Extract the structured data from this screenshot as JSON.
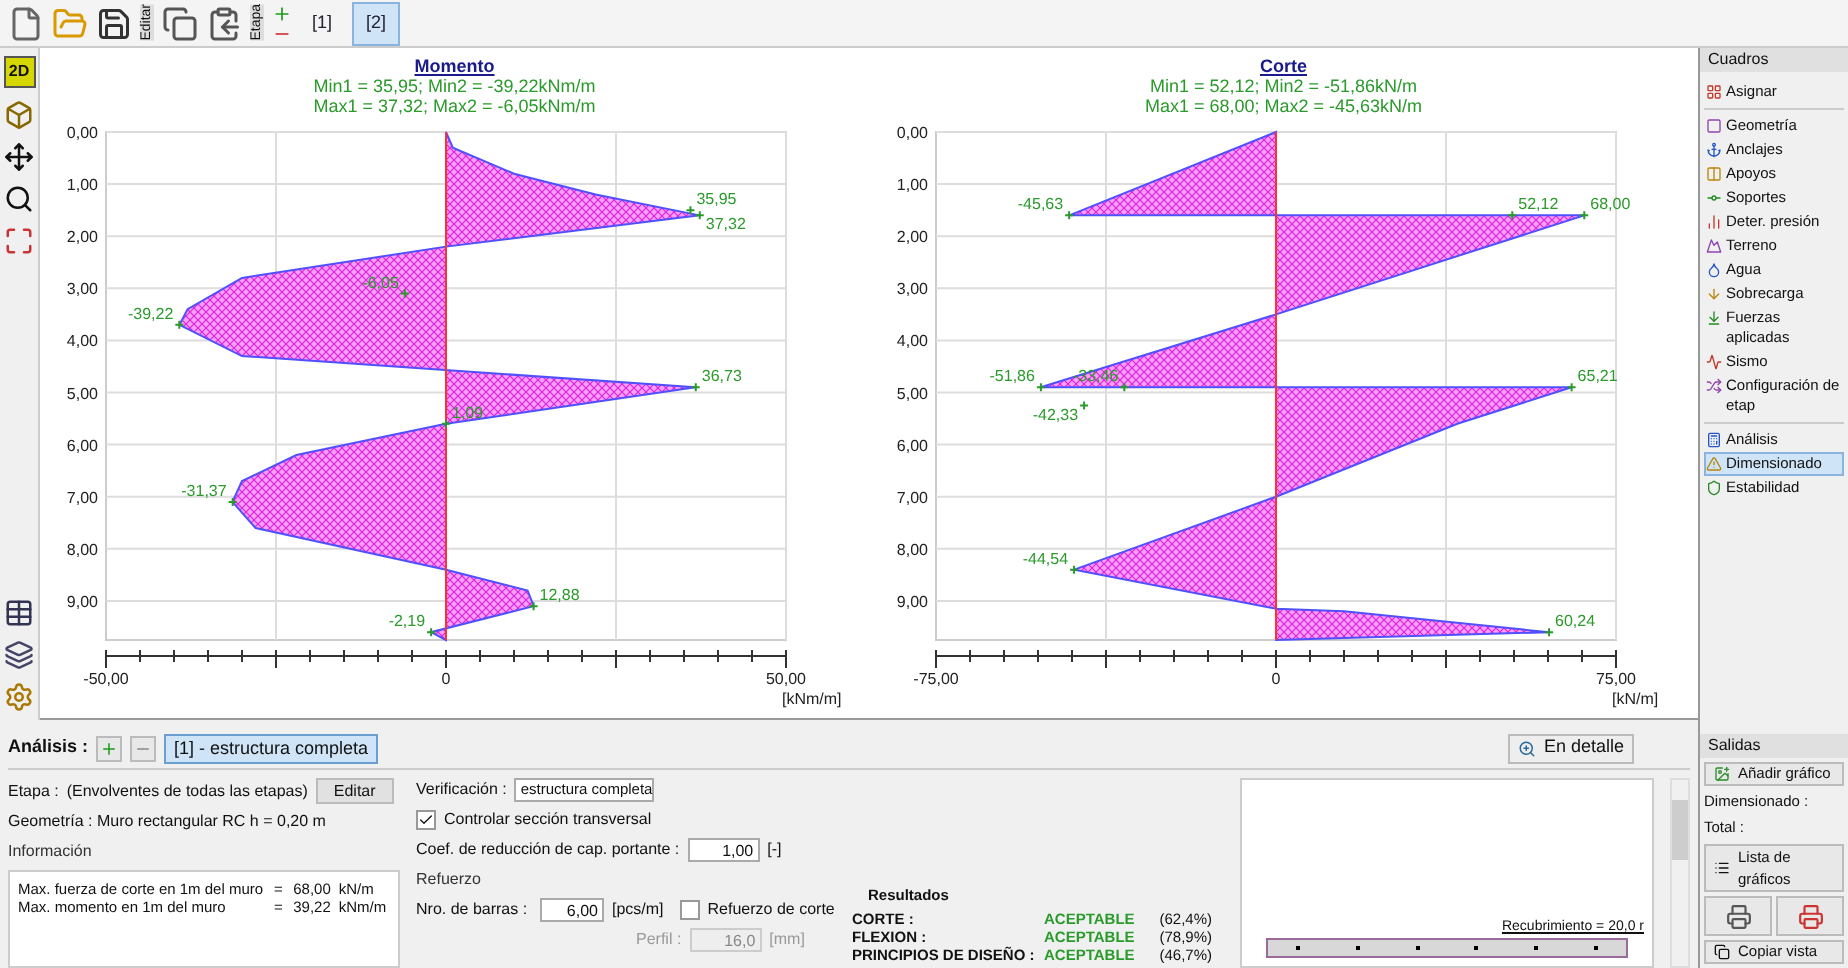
{
  "toolbar": {
    "edit_label": "Editar",
    "stage_label": "Etapa",
    "stages": [
      {
        "label": "[1]",
        "selected": false
      },
      {
        "label": "[2]",
        "selected": true
      }
    ]
  },
  "left_toolbar": {
    "view_button": {
      "label": "2D",
      "selected": true
    }
  },
  "charts": [
    {
      "summary": [
        "Min1 = 35,95; Min2 = -39,22kNm/m",
        "Max1 = 37,32; Max2 = -6,05kNm/m"
      ],
      "chart_data": {
        "type": "area",
        "title": "Momento",
        "orientation": "horizontal",
        "xlabel": "[kNm/m]",
        "grid": true,
        "xlim": [
          -50,
          50
        ],
        "ylim": [
          9.75,
          0
        ],
        "x": [
          0,
          0.3,
          0.8,
          1.2,
          1.6,
          2.2,
          2.8,
          3.4,
          3.7,
          4.3,
          4.9,
          5.6,
          6.2,
          6.7,
          7.1,
          7.6,
          8.4,
          8.8,
          9.1,
          9.6,
          9.75
        ],
        "series": [
          {
            "color": "#5050ff",
            "values": [
              0,
              1,
              10,
              22,
              37.3,
              0,
              -30,
              -38,
              -39.2,
              -30,
              36.7,
              0,
              -22,
              -30,
              -31.4,
              -28,
              0,
              12,
              12.9,
              -2.2,
              0
            ]
          }
        ],
        "xticks": [
          {
            "value": -50,
            "label": "-50,00"
          },
          {
            "value": 0,
            "label": "0"
          },
          {
            "value": 50,
            "label": "50,00"
          }
        ],
        "yticks": [
          {
            "value": 0,
            "label": "0,00"
          },
          {
            "value": 1,
            "label": "1,00"
          },
          {
            "value": 2,
            "label": "2,00"
          },
          {
            "value": 3,
            "label": "3,00"
          },
          {
            "value": 4,
            "label": "4,00"
          },
          {
            "value": 5,
            "label": "5,00"
          },
          {
            "value": 6,
            "label": "6,00"
          },
          {
            "value": 7,
            "label": "7,00"
          },
          {
            "value": 8,
            "label": "8,00"
          },
          {
            "value": 9,
            "label": "9,00"
          }
        ],
        "annotations": [
          {
            "x": 35.95,
            "y": 1.5,
            "text": "35,95"
          },
          {
            "x": 37.32,
            "y": 1.6,
            "text": "37,32"
          },
          "-6,05",
          {
            "x": -39.22,
            "y": 3.7,
            "text": "-39,22"
          },
          {
            "x": 36.73,
            "y": 4.9,
            "text": "36,73"
          },
          {
            "x": 0,
            "y": 5.6,
            "text": "1,09"
          },
          {
            "x": -31.37,
            "y": 7.1,
            "text": "-31,37"
          },
          {
            "x": 12.88,
            "y": 9.1,
            "text": "12,88"
          },
          {
            "x": -2.19,
            "y": 9.6,
            "text": "-2,19"
          }
        ]
      }
    },
    {
      "summary": [
        "Min1 = 52,12; Min2 = -51,86kN/m",
        "Max1 = 68,00; Max2 = -45,63kN/m"
      ],
      "chart_data": {
        "type": "area",
        "title": "Corte",
        "orientation": "horizontal",
        "xlabel": "[kN/m]",
        "grid": true,
        "xlim": [
          -75,
          75
        ],
        "ylim": [
          9.75,
          0
        ],
        "x": [
          0,
          1.6,
          1.6,
          3.5,
          4.9,
          4.9,
          5.6,
          7.0,
          8.4,
          9.15,
          9.2,
          9.6,
          9.75
        ],
        "series": [
          {
            "color": "#5050ff",
            "values": [
              0,
              -45.6,
              68,
              0,
              -51.9,
              65.2,
              40,
              0,
              -44.5,
              0,
              15,
              60.2,
              0
            ]
          }
        ],
        "xticks": [
          {
            "value": -75,
            "label": "-75,00"
          },
          {
            "value": 0,
            "label": "0"
          },
          {
            "value": 75,
            "label": "75,00"
          }
        ],
        "yticks": [
          {
            "value": 0,
            "label": "0,00"
          },
          {
            "value": 1,
            "label": "1,00"
          },
          {
            "value": 2,
            "label": "2,00"
          },
          {
            "value": 3,
            "label": "3,00"
          },
          {
            "value": 4,
            "label": "4,00"
          },
          {
            "value": 5,
            "label": "5,00"
          },
          {
            "value": 6,
            "label": "6,00"
          },
          {
            "value": 7,
            "label": "7,00"
          },
          {
            "value": 8,
            "label": "8,00"
          },
          {
            "value": 9,
            "label": "9,00"
          }
        ],
        "annotations": [
          {
            "x": -45.63,
            "y": 1.6,
            "text": "-45,63"
          },
          {
            "x": 52.12,
            "y": 1.6,
            "text": "52,12"
          },
          {
            "x": 68,
            "y": 1.6,
            "text": "68,00"
          },
          {
            "x": -51.86,
            "y": 4.9,
            "text": "-51,86"
          },
          {
            "x": -33.46,
            "y": 4.9,
            "text": "-33,46"
          },
          "-42,33",
          {
            "x": 65.21,
            "y": 4.9,
            "text": "65,21"
          },
          {
            "x": -44.54,
            "y": 8.4,
            "text": "-44,54"
          },
          {
            "x": 60.24,
            "y": 9.6,
            "text": "60,24"
          }
        ]
      }
    }
  ],
  "analysis": {
    "label": "Análisis :",
    "tabs": [
      {
        "label": "[1] - estructura completa",
        "selected": true
      }
    ],
    "detail_button": "En detalle"
  },
  "stage": {
    "label": "Etapa :",
    "value": "(Envolventes de todas las etapas)",
    "button": "Editar"
  },
  "geometry": "Geometría : Muro rectangular RC h = 0,20 m",
  "information": {
    "title": "Información",
    "lines": [
      {
        "label": "Max. fuerza de corte en 1m del muro",
        "eq": "=",
        "value": "68,00",
        "unit": "kN/m"
      },
      {
        "label": "Max. momento en 1m del muro",
        "eq": "=",
        "value": "39,22",
        "unit": "kNm/m"
      }
    ]
  },
  "verification": {
    "label": "Verificación :",
    "value": "estructura completa"
  },
  "check_section": {
    "label": "Controlar sección transversal",
    "checked": true
  },
  "coef": {
    "label": "Coef. de reducción de cap. portante :",
    "value": "1,00",
    "unit": "[-]"
  },
  "reinforcement": {
    "title": "Refuerzo",
    "bars": {
      "label": "Nro. de barras :",
      "value": "6,00",
      "unit": "[pcs/m]"
    },
    "shear": {
      "label": "Refuerzo de corte",
      "checked": false
    },
    "profile": {
      "label": "Perfil :",
      "value": "16,0",
      "unit": "[mm]",
      "disabled": true
    }
  },
  "results": {
    "title": "Resultados",
    "rows": [
      {
        "name": "CORTE :",
        "status": "ACEPTABLE",
        "percent": "(62,4%)"
      },
      {
        "name": "FLEXION :",
        "status": "ACEPTABLE",
        "percent": "(78,9%)"
      },
      {
        "name": "PRINCIPIOS DE DISEÑO :",
        "status": "ACEPTABLE",
        "percent": "(46,7%)"
      }
    ]
  },
  "preview": {
    "cover_label": "Recubrimiento = 20,0 r"
  },
  "sidebar": {
    "title": "Cuadros",
    "groups": [
      {
        "items": [
          {
            "label": "Asignar",
            "selected": false
          }
        ]
      },
      {
        "items": [
          {
            "label": "Geometría",
            "selected": false
          },
          {
            "label": "Anclajes",
            "selected": false
          },
          {
            "label": "Apoyos",
            "selected": false
          },
          {
            "label": "Soportes",
            "selected": false
          },
          {
            "label": "Deter. presión",
            "selected": false
          },
          {
            "label": "Terreno",
            "selected": false
          },
          {
            "label": "Agua",
            "selected": false
          },
          {
            "label": "Sobrecarga",
            "selected": false
          },
          {
            "label": "Fuerzas aplicadas",
            "selected": false
          },
          {
            "label": "Sismo",
            "selected": false
          },
          {
            "label": "Configuración de etap",
            "selected": false
          }
        ]
      },
      {
        "items": [
          {
            "label": "Análisis",
            "selected": false
          },
          {
            "label": "Dimensionado",
            "selected": true
          },
          {
            "label": "Estabilidad",
            "selected": false
          }
        ]
      }
    ]
  },
  "outputs": {
    "title": "Salidas",
    "add": "Añadir gráfico",
    "lines": [
      "Dimensionado :",
      "Total :"
    ],
    "list": "Lista de gráficos",
    "copy": "Copiar vista"
  }
}
